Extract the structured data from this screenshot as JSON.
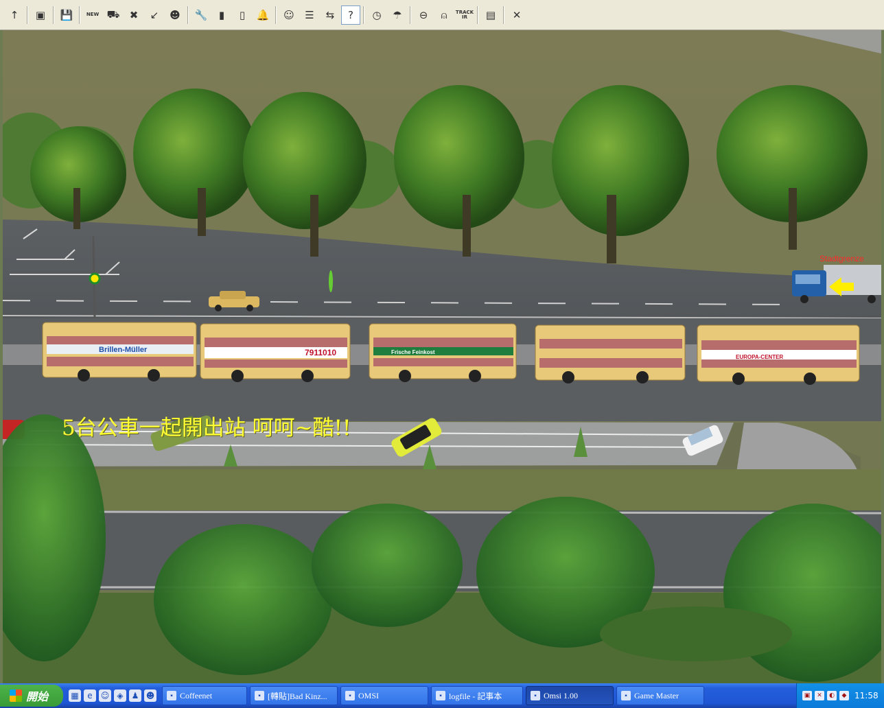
{
  "toolbar": {
    "buttons": [
      {
        "name": "up-arrow-icon",
        "glyph": "↑"
      },
      {
        "name": "map-icon",
        "glyph": "▣"
      },
      {
        "name": "save-icon",
        "glyph": "💾"
      },
      {
        "name": "new-bus-icon",
        "glyph": "NEW"
      },
      {
        "name": "bus-icon",
        "glyph": "⛟"
      },
      {
        "name": "delete-bus-icon",
        "glyph": "✖"
      },
      {
        "name": "tool-icon",
        "glyph": "↙"
      },
      {
        "name": "passenger-icon",
        "glyph": "☻"
      },
      {
        "name": "wrench-icon",
        "glyph": "🔧"
      },
      {
        "name": "door-icon",
        "glyph": "▮"
      },
      {
        "name": "door-open-icon",
        "glyph": "▯"
      },
      {
        "name": "bell-icon",
        "glyph": "🔔"
      },
      {
        "name": "driver-icon",
        "glyph": "☺"
      },
      {
        "name": "timetable-icon",
        "glyph": "☰"
      },
      {
        "name": "route-swap-icon",
        "glyph": "⇆"
      },
      {
        "name": "help-arrow-icon",
        "glyph": "?"
      },
      {
        "name": "clock-icon",
        "glyph": "◷"
      },
      {
        "name": "weather-icon",
        "glyph": "☂"
      },
      {
        "name": "camera-icon",
        "glyph": "⊖"
      },
      {
        "name": "mouse-icon",
        "glyph": "⍝"
      },
      {
        "name": "track-ir-icon",
        "glyph": "TRACK IR"
      },
      {
        "name": "options-icon",
        "glyph": "▤"
      },
      {
        "name": "close-icon",
        "glyph": "✕"
      }
    ],
    "active_button": "help-arrow-icon"
  },
  "scene": {
    "caption": "5台公車一起開出站  呵呵~酷!!",
    "sign_text": "Stadtgrenze",
    "bus_ads": [
      "Brillen-Müller",
      "7911010",
      "Frische Feinkost",
      "",
      "EUROPA-CENTER"
    ]
  },
  "taskbar": {
    "start_label": "開始",
    "tasks": [
      {
        "label": "Coffeenet",
        "icon": "coffee-icon",
        "active": false
      },
      {
        "label": "[轉貼]Bad Kinz...",
        "icon": "ie-icon",
        "active": false
      },
      {
        "label": "OMSI",
        "icon": "folder-icon",
        "active": false
      },
      {
        "label": "logfile - 記事本",
        "icon": "notepad-icon",
        "active": false
      },
      {
        "label": "Omsi 1.00",
        "icon": "omsi-icon",
        "active": true
      },
      {
        "label": "Game Master",
        "icon": "gamemaster-icon",
        "active": false
      }
    ],
    "clock": "11:58"
  },
  "colors": {
    "caption": "#ffff33",
    "taskbar": "#245edb",
    "start": "#3a9b36",
    "bus": "#e8c97a"
  }
}
